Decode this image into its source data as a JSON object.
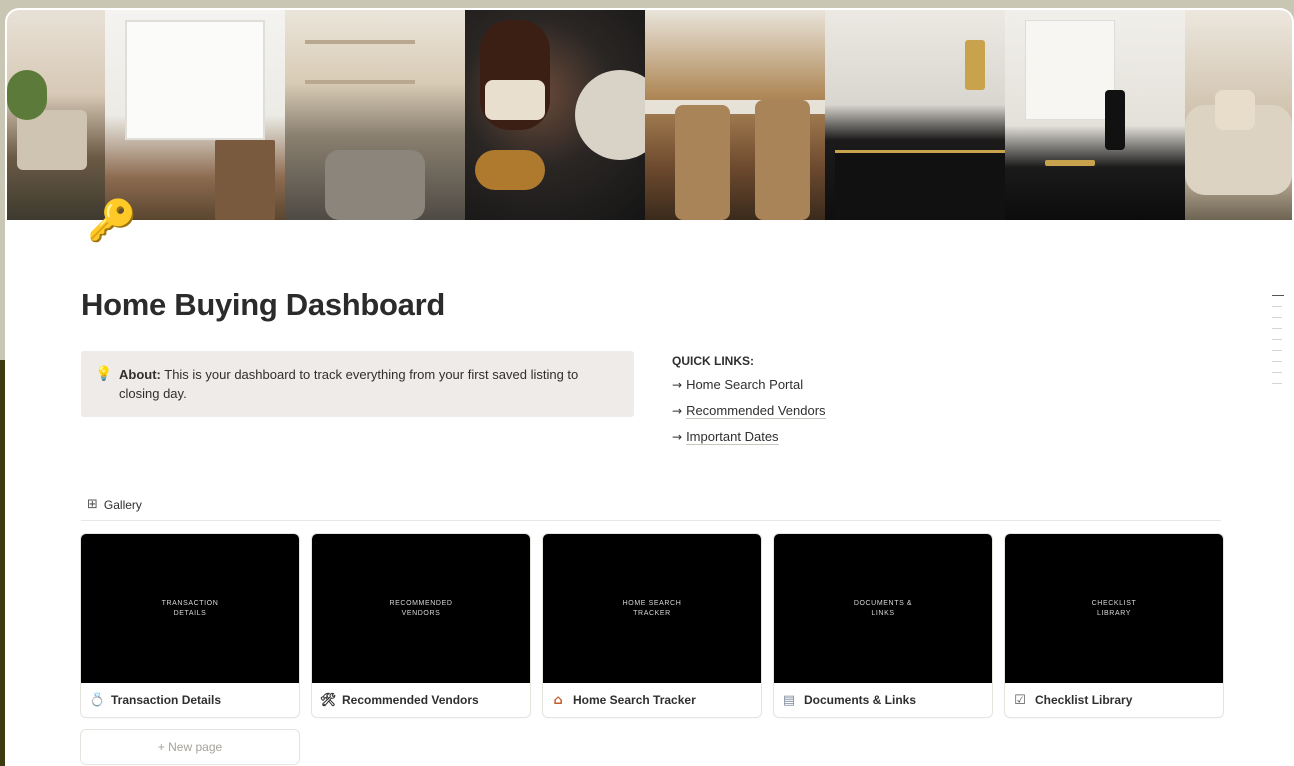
{
  "page": {
    "title": "Home Buying Dashboard",
    "icon": "key-icon"
  },
  "callout": {
    "icon": "lightbulb-icon",
    "bold": "About:",
    "text": " This is your dashboard to track everything from your first saved listing to closing day."
  },
  "quick_links": {
    "title": "QUICK LINKS:",
    "items": [
      {
        "label": "Home Search Portal"
      },
      {
        "label": "Recommended Vendors"
      },
      {
        "label": "Important Dates"
      }
    ]
  },
  "gallery": {
    "tab_label": "Gallery",
    "cards": [
      {
        "thumb_text": "TRANSACTION\nDETAILS",
        "icon": "ring-icon",
        "label": "Transaction Details"
      },
      {
        "thumb_text": "RECOMMENDED\nVENDORS",
        "icon": "tools-icon",
        "label": "Recommended Vendors"
      },
      {
        "thumb_text": "HOME SEARCH\nTRACKER",
        "icon": "house-icon",
        "label": "Home Search Tracker"
      },
      {
        "thumb_text": "DOCUMENTS &\nLINKS",
        "icon": "folder-icon",
        "label": "Documents & Links"
      },
      {
        "thumb_text": "CHECKLIST\nLIBRARY",
        "icon": "checkbox-icon",
        "label": "Checklist Library"
      }
    ],
    "new_page_label": "+ New page"
  },
  "colors": {
    "backdrop_olive": "#3b3a10",
    "callout_bg": "#efebe8",
    "card_thumb": "#000000",
    "key_gold": "#d49a2a"
  }
}
